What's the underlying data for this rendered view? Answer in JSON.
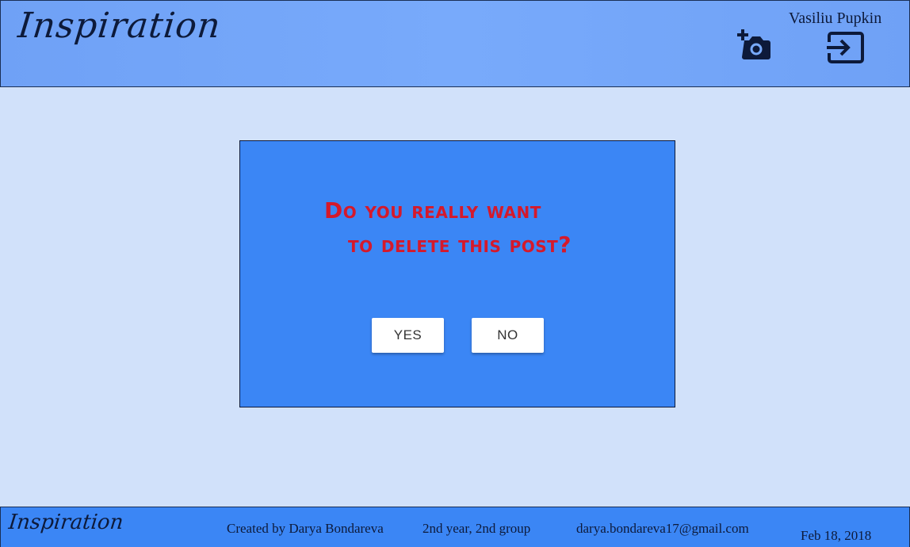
{
  "header": {
    "logo": "Inspiration",
    "user_name": "Vasiliu Pupkin",
    "add_photo_icon": "add-photo-camera-icon",
    "logout_icon": "logout-icon"
  },
  "dialog": {
    "question_line1": "Do you really want",
    "question_line2": "to delete this post?",
    "yes_label": "YES",
    "no_label": "NO"
  },
  "footer": {
    "logo": "Inspiration",
    "author": "Created by Darya Bondareva",
    "group": "2nd year, 2nd group",
    "email": "darya.bondareva17@gmail.com",
    "date": "Feb 18, 2018"
  },
  "colors": {
    "header_bg": "#78aafb",
    "page_bg": "#d1e1fa",
    "dialog_bg": "#3b86f5",
    "question_text": "#d5192b",
    "icon": "#0d1a3a"
  }
}
